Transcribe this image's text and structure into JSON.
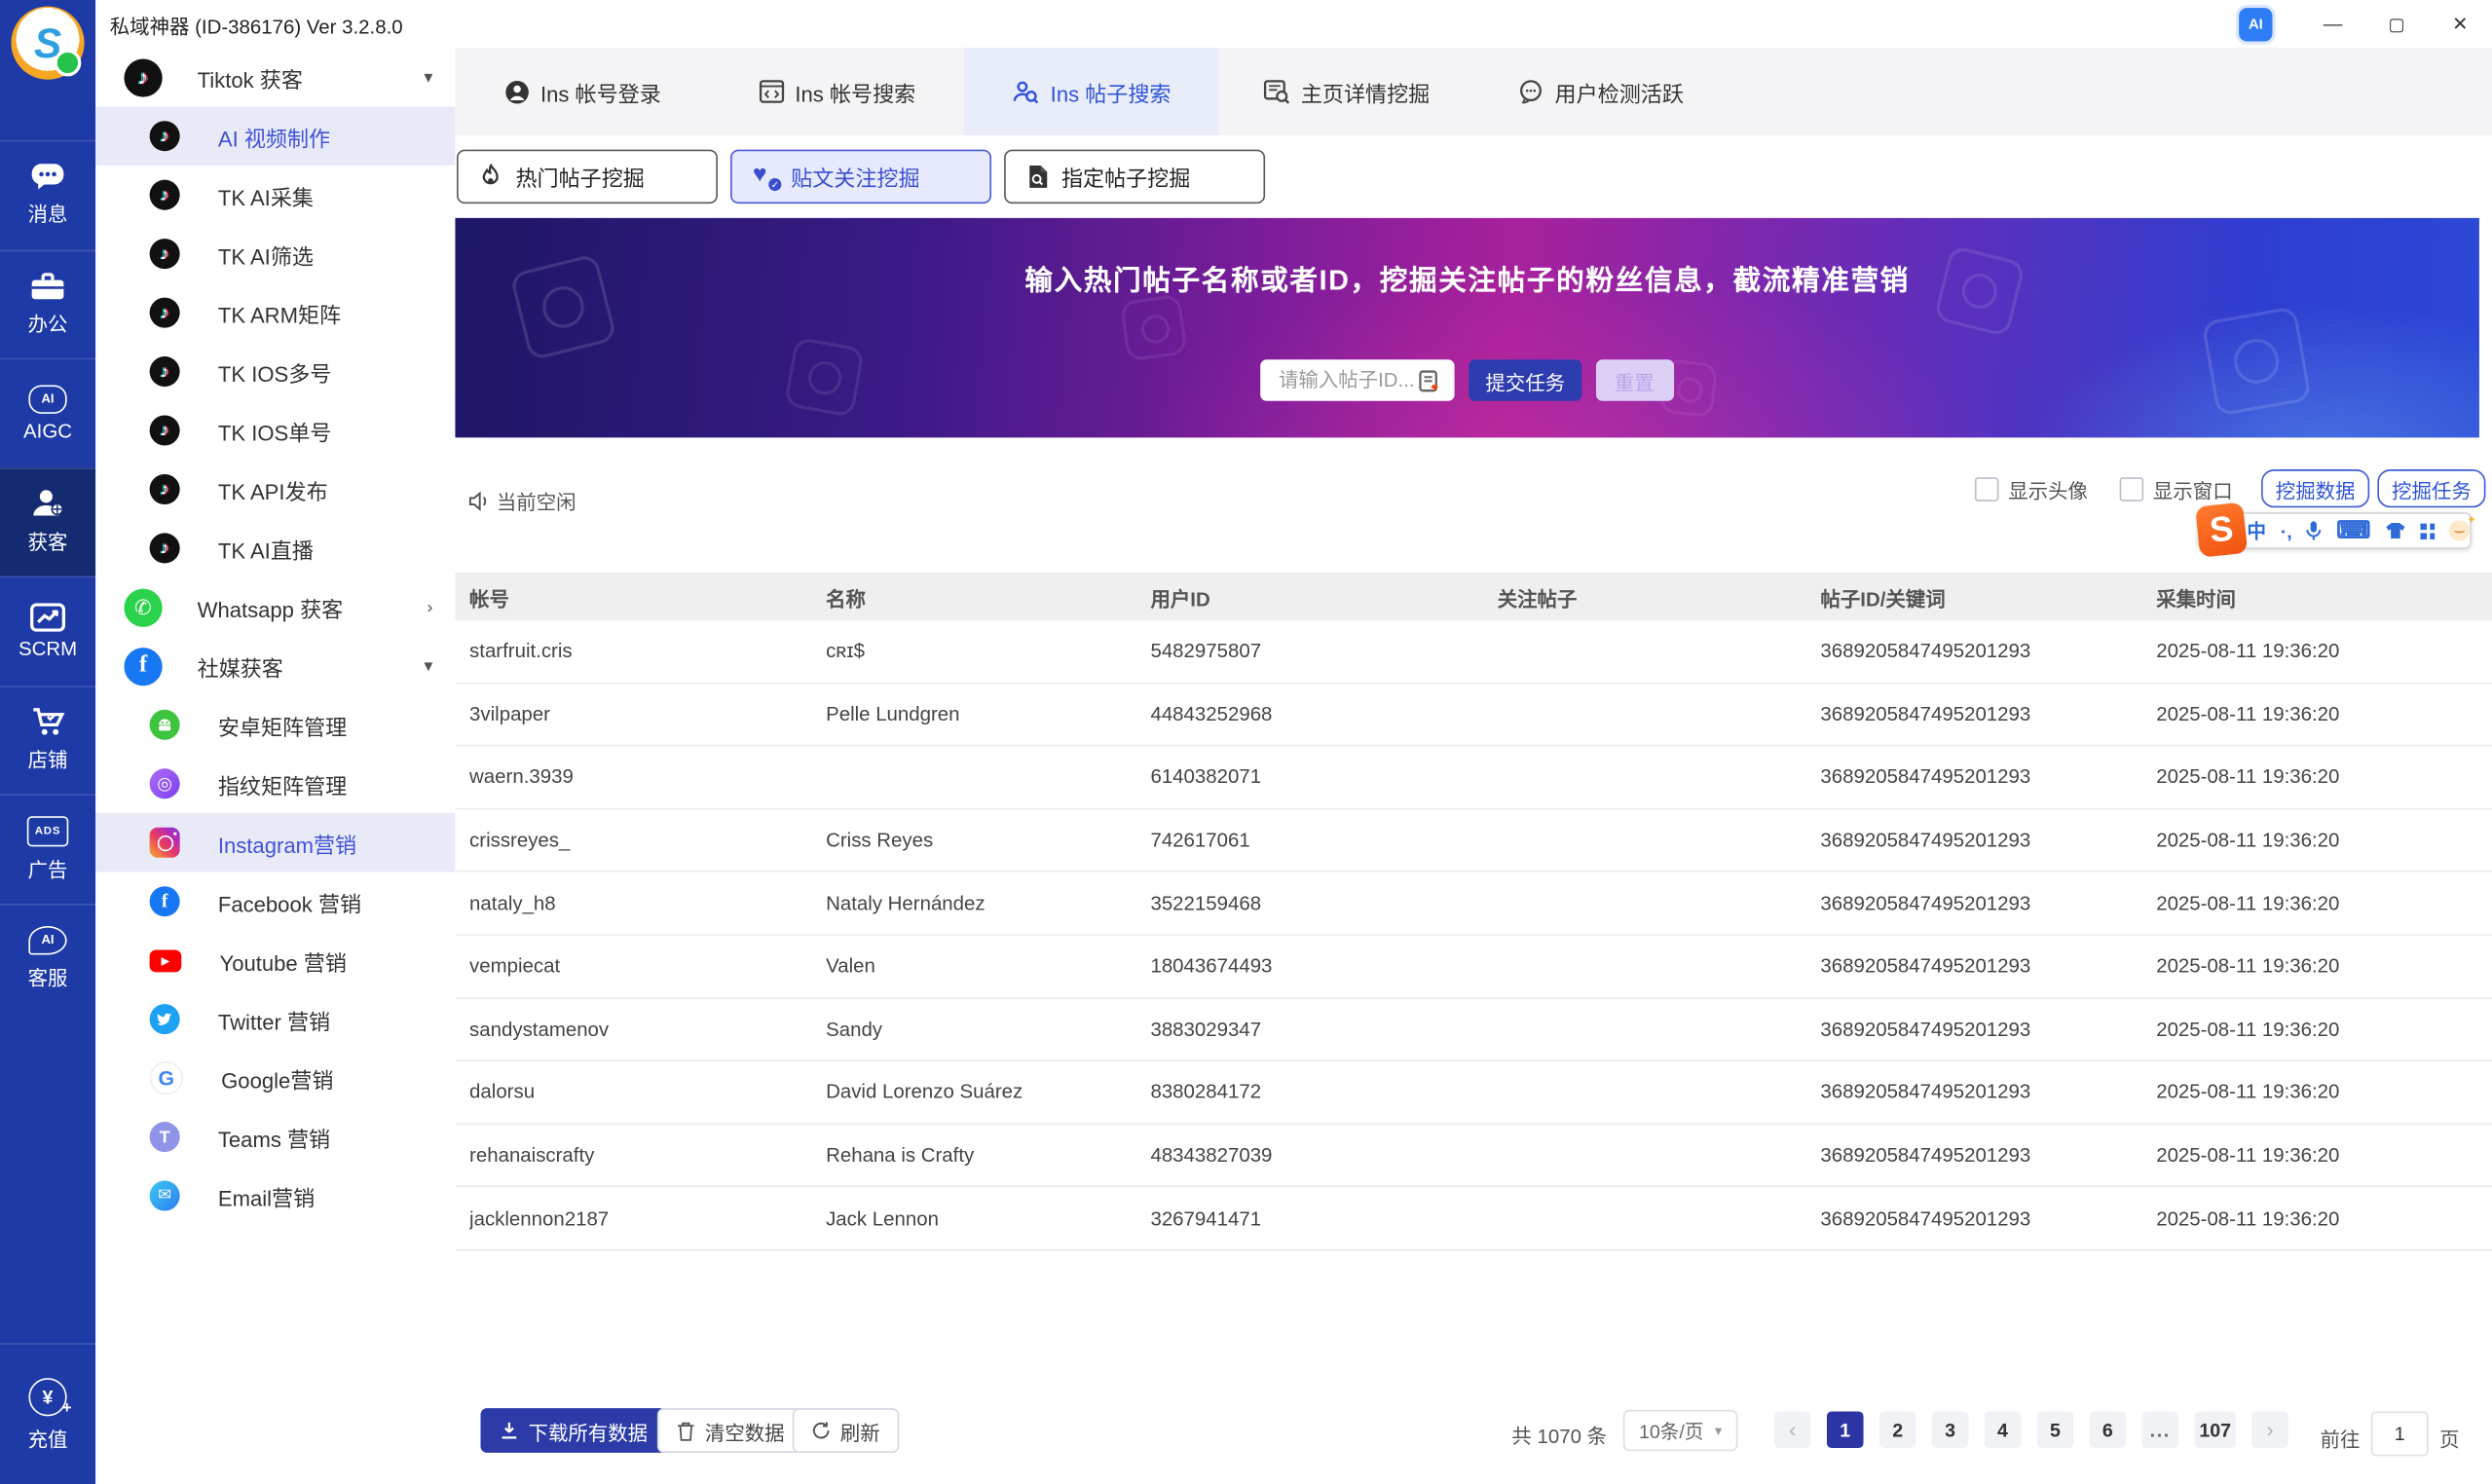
{
  "titlebar": {
    "title": "私域神器 (ID-386176) Ver 3.2.8.0",
    "ai_badge": "AI",
    "minimize": "—",
    "maximize": "▢",
    "close": "✕"
  },
  "rail": {
    "items": [
      {
        "label": "消息"
      },
      {
        "label": "办公"
      },
      {
        "label": "AIGC"
      },
      {
        "label": "获客"
      },
      {
        "label": "SCRM"
      },
      {
        "label": "店铺"
      },
      {
        "label": "广告"
      },
      {
        "label": "客服"
      }
    ],
    "bottom_label": "充值",
    "ai_text": "AI",
    "ads_text": "ADS",
    "yuan": "¥",
    "plus": "+"
  },
  "sidebar": {
    "items": [
      {
        "label": "Tiktok 获客"
      },
      {
        "label": "AI 视频制作"
      },
      {
        "label": "TK AI采集"
      },
      {
        "label": "TK AI筛选"
      },
      {
        "label": "TK ARM矩阵"
      },
      {
        "label": "TK IOS多号"
      },
      {
        "label": "TK IOS单号"
      },
      {
        "label": "TK API发布"
      },
      {
        "label": "TK AI直播"
      },
      {
        "label": "Whatsapp 获客"
      },
      {
        "label": "社媒获客"
      },
      {
        "label": "安卓矩阵管理"
      },
      {
        "label": "指纹矩阵管理"
      },
      {
        "label": "Instagram营销"
      },
      {
        "label": "Facebook 营销"
      },
      {
        "label": "Youtube 营销"
      },
      {
        "label": "Twitter 营销"
      },
      {
        "label": "Google营销"
      },
      {
        "label": "Teams 营销"
      },
      {
        "label": "Email营销"
      }
    ],
    "caret_down": "▾",
    "caret_right": "›"
  },
  "tabs": [
    {
      "label": "Ins 帐号登录"
    },
    {
      "label": "Ins 帐号搜索"
    },
    {
      "label": "Ins 帖子搜索"
    },
    {
      "label": "主页详情挖掘"
    },
    {
      "label": "用户检测活跃"
    }
  ],
  "subtabs": [
    {
      "label": "热门帖子挖掘"
    },
    {
      "label": "贴文关注挖掘"
    },
    {
      "label": "指定帖子挖掘"
    }
  ],
  "banner": {
    "headline": "输入热门帖子名称或者ID，挖掘关注帖子的粉丝信息，截流精准营销",
    "input_placeholder": "请输入帖子ID...",
    "submit_label": "提交任务",
    "reset_label": "重置"
  },
  "status": {
    "idle_text": "当前空闲",
    "checkbox_avatar": "显示头像",
    "checkbox_window": "显示窗口",
    "mine_data_label": "挖掘数据",
    "mine_task_label": "挖掘任务"
  },
  "ime": {
    "logo": "S",
    "mode": "中",
    "punct": "·,",
    "keyboard": "⌨"
  },
  "table": {
    "columns": [
      "帐号",
      "名称",
      "用户ID",
      "关注帖子",
      "帖子ID/关键词",
      "采集时间"
    ],
    "rows": [
      [
        "starfruit.cris",
        "ᴄʀɪ$",
        "5482975807",
        "",
        "3689205847495201293",
        "2025-08-11 19:36:20"
      ],
      [
        "3vilpaper",
        "Pelle Lundgren",
        "44843252968",
        "",
        "3689205847495201293",
        "2025-08-11 19:36:20"
      ],
      [
        "waern.3939",
        "",
        "6140382071",
        "",
        "3689205847495201293",
        "2025-08-11 19:36:20"
      ],
      [
        "crissreyes_",
        "Criss Reyes",
        "742617061",
        "",
        "3689205847495201293",
        "2025-08-11 19:36:20"
      ],
      [
        "nataly_h8",
        "Nataly Hernández",
        "3522159468",
        "",
        "3689205847495201293",
        "2025-08-11 19:36:20"
      ],
      [
        "vempiecat",
        "Valen",
        "18043674493",
        "",
        "3689205847495201293",
        "2025-08-11 19:36:20"
      ],
      [
        "sandystamenov",
        "Sandy",
        "3883029347",
        "",
        "3689205847495201293",
        "2025-08-11 19:36:20"
      ],
      [
        "dalorsu",
        "David Lorenzo Suárez",
        "8380284172",
        "",
        "3689205847495201293",
        "2025-08-11 19:36:20"
      ],
      [
        "rehanaiscrafty",
        "Rehana is Crafty",
        "48343827039",
        "",
        "3689205847495201293",
        "2025-08-11 19:36:20"
      ],
      [
        "jacklennon2187",
        "Jack Lennon",
        "3267941471",
        "",
        "3689205847495201293",
        "2025-08-11 19:36:20"
      ]
    ]
  },
  "footer": {
    "download_label": "下载所有数据",
    "clear_label": "清空数据",
    "refresh_label": "刷新",
    "total_text": "共 1070 条",
    "page_size": "10条/页",
    "pages": [
      "1",
      "2",
      "3",
      "4",
      "5",
      "6",
      "...",
      "107"
    ],
    "active_page": "1",
    "prev": "‹",
    "next": "›",
    "goto_prefix": "前往",
    "goto_value": "1",
    "goto_suffix": "页"
  },
  "icons": {
    "tiktok_note": "♪",
    "whatsapp_phone": "✆",
    "facebook_f": "f",
    "youtube_play": "▶",
    "google_g": "G",
    "teams_t": "T",
    "email_envelope": "✉",
    "fingerprint_ring": "◎",
    "heart": "♥",
    "check": "✓",
    "flame_caret": "▾"
  }
}
